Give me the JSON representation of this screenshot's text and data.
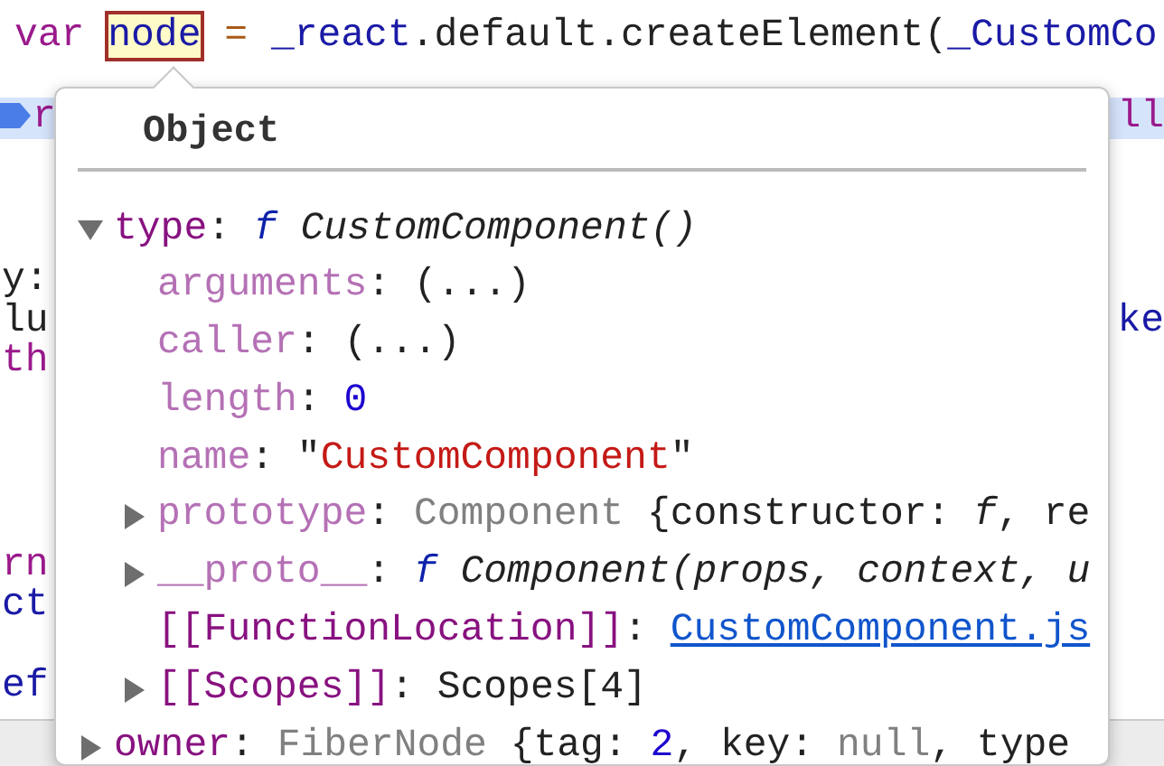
{
  "code_lines": [
    {
      "kind": "code",
      "segments": [
        {
          "text": "var ",
          "kind": "keyword"
        },
        {
          "text": "node",
          "kind": "hovered"
        },
        {
          "text": " = ",
          "kind": "operator"
        },
        {
          "text": "_react",
          "kind": "variable"
        },
        {
          "text": ".default.createElement(",
          "kind": "plain"
        },
        {
          "text": "_CustomCo",
          "kind": "variable"
        }
      ]
    },
    {
      "kind": "blank"
    },
    {
      "kind": "breakpoint",
      "segments": [
        {
          "text": "r",
          "kind": "keyword"
        }
      ],
      "right": [
        {
          "text": "ll",
          "kind": "keyword"
        }
      ]
    },
    {
      "kind": "blank"
    },
    {
      "kind": "blank"
    },
    {
      "kind": "blank"
    },
    {
      "kind": "code",
      "segments": [
        {
          "text": "y:",
          "kind": "plain"
        }
      ]
    },
    {
      "kind": "code",
      "segments": [
        {
          "text": "lu",
          "kind": "plain"
        }
      ],
      "right": [
        {
          "text": "ke",
          "kind": "variable"
        }
      ]
    },
    {
      "kind": "code",
      "segments": [
        {
          "text": "th",
          "kind": "keyword"
        }
      ]
    },
    {
      "kind": "blank"
    },
    {
      "kind": "blank"
    },
    {
      "kind": "blank"
    },
    {
      "kind": "blank"
    },
    {
      "kind": "code",
      "segments": [
        {
          "text": "rn",
          "kind": "keyword"
        }
      ]
    },
    {
      "kind": "code",
      "segments": [
        {
          "text": "ct",
          "kind": "variable"
        }
      ]
    },
    {
      "kind": "blank"
    },
    {
      "kind": "code",
      "segments": [
        {
          "text": "ef",
          "kind": "variable"
        }
      ]
    }
  ],
  "popover": {
    "title": "Object",
    "properties": [
      {
        "key": "type",
        "dimmed": false,
        "expanded": true,
        "value": [
          {
            "text": ": ",
            "kind": "plain"
          },
          {
            "text": "f",
            "kind": "f"
          },
          {
            "text": " CustomComponent()",
            "kind": "italic"
          }
        ],
        "children": [
          {
            "key": "arguments",
            "dimmed": true,
            "value": [
              {
                "text": ": (...)",
                "kind": "plain"
              }
            ]
          },
          {
            "key": "caller",
            "dimmed": true,
            "value": [
              {
                "text": ": (...)",
                "kind": "plain"
              }
            ]
          },
          {
            "key": "length",
            "dimmed": true,
            "value": [
              {
                "text": ": ",
                "kind": "plain"
              },
              {
                "text": "0",
                "kind": "number"
              }
            ]
          },
          {
            "key": "name",
            "dimmed": true,
            "value": [
              {
                "text": ": \"",
                "kind": "plain"
              },
              {
                "text": "CustomComponent",
                "kind": "string"
              },
              {
                "text": "\"",
                "kind": "plain"
              }
            ]
          },
          {
            "key": "prototype",
            "dimmed": true,
            "expanded": false,
            "value": [
              {
                "text": ": ",
                "kind": "plain"
              },
              {
                "text": "Component",
                "kind": "grey"
              },
              {
                "text": " {constructor: ",
                "kind": "plain"
              },
              {
                "text": "f",
                "kind": "italic"
              },
              {
                "text": ", re",
                "kind": "plain"
              }
            ]
          },
          {
            "key": "__proto__",
            "dimmed": true,
            "expanded": false,
            "value": [
              {
                "text": ": ",
                "kind": "plain"
              },
              {
                "text": "f",
                "kind": "f"
              },
              {
                "text": " Component(props, context, u",
                "kind": "italic"
              }
            ]
          },
          {
            "key": "[[FunctionLocation]]",
            "dimmed": false,
            "value": [
              {
                "text": ": ",
                "kind": "plain"
              },
              {
                "text": "CustomComponent.js",
                "kind": "link"
              }
            ]
          },
          {
            "key": "[[Scopes]]",
            "dimmed": false,
            "expanded": false,
            "value": [
              {
                "text": ": Scopes[4]",
                "kind": "plain"
              }
            ]
          }
        ]
      },
      {
        "key": "owner",
        "dimmed": false,
        "expanded": false,
        "value": [
          {
            "text": ": ",
            "kind": "plain"
          },
          {
            "text": "FiberNode",
            "kind": "grey"
          },
          {
            "text": " {tag: ",
            "kind": "plain"
          },
          {
            "text": "2",
            "kind": "number"
          },
          {
            "text": ", key: ",
            "kind": "plain"
          },
          {
            "text": "null",
            "kind": "grey"
          },
          {
            "text": ", type",
            "kind": "plain"
          }
        ]
      }
    ]
  }
}
